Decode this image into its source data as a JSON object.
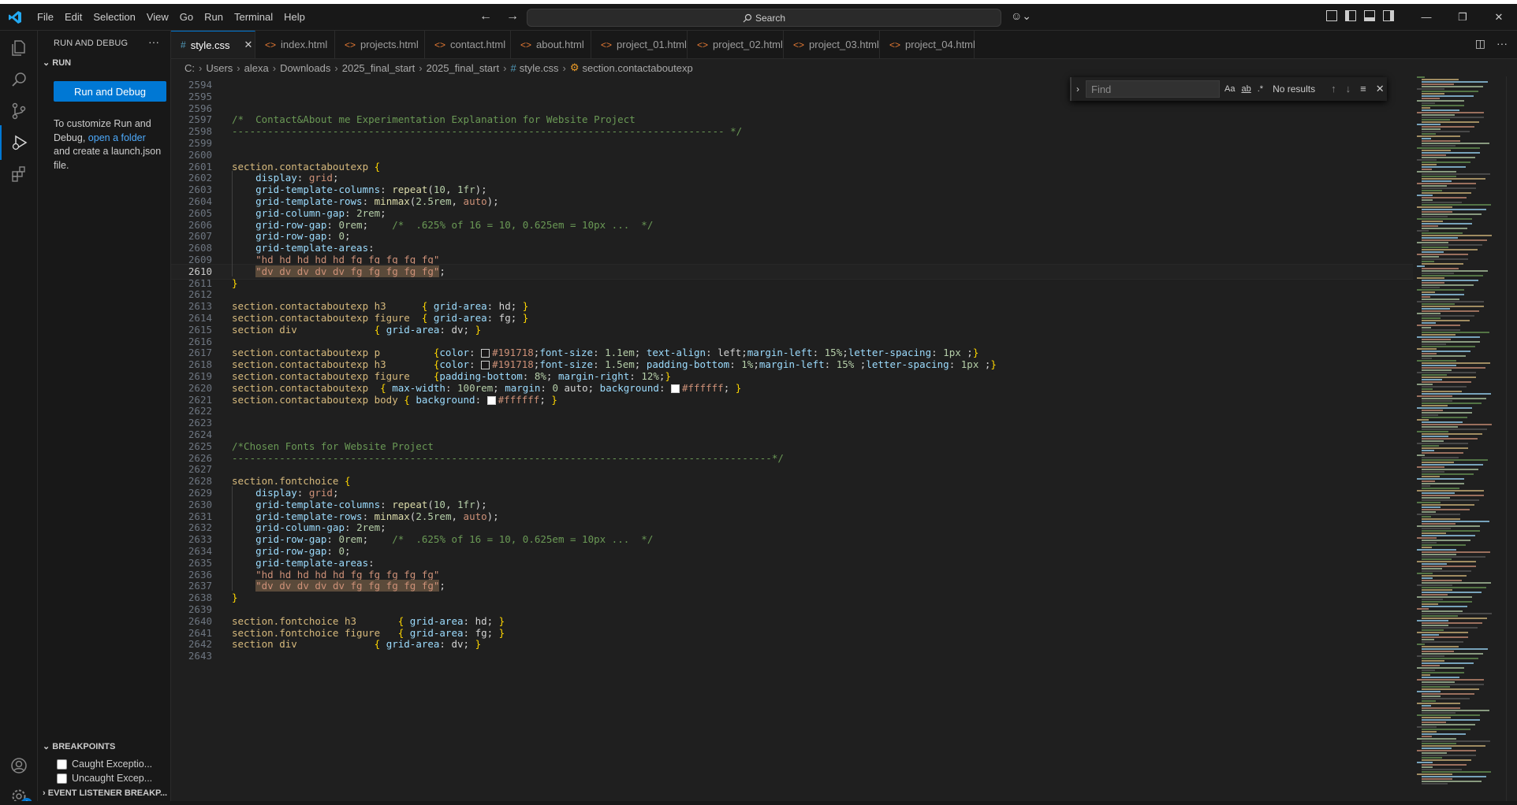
{
  "menu": [
    "File",
    "Edit",
    "Selection",
    "View",
    "Go",
    "Run",
    "Terminal",
    "Help"
  ],
  "search": {
    "label": "Search"
  },
  "sidebar": {
    "title": "RUN AND DEBUG",
    "section": "RUN",
    "run_button": "Run and Debug",
    "text_before": "To customize Run and Debug,",
    "link": "open a folder",
    "text_after": "and create a launch.json file.",
    "breakpoints_title": "BREAKPOINTS",
    "bp_items": [
      "Caught Exceptio...",
      "Uncaught Excep..."
    ],
    "event_listener": "EVENT LISTENER BREAKP..."
  },
  "tabs": [
    {
      "label": "style.css",
      "type": "css",
      "active": true
    },
    {
      "label": "index.html",
      "type": "html"
    },
    {
      "label": "projects.html",
      "type": "html"
    },
    {
      "label": "contact.html",
      "type": "html"
    },
    {
      "label": "about.html",
      "type": "html"
    },
    {
      "label": "project_01.html",
      "type": "html"
    },
    {
      "label": "project_02.html",
      "type": "html"
    },
    {
      "label": "project_03.html",
      "type": "html"
    },
    {
      "label": "project_04.html",
      "type": "html"
    }
  ],
  "breadcrumb": [
    "C:",
    "Users",
    "alexa",
    "Downloads",
    "2025_final_start",
    "2025_final_start",
    "style.css",
    "section.contactaboutexp"
  ],
  "find": {
    "placeholder": "Find",
    "result": "No results",
    "opt_case": "Aa",
    "opt_word": "ab",
    "opt_regex": ".*"
  },
  "activity_badge": "1",
  "colors": {
    "accent": "#0078d4",
    "editor_bg": "#1f1f1f",
    "swatch_dark": "#191718",
    "swatch_light": "#ffffff"
  },
  "editor": {
    "current_line": "2610",
    "lines": [
      {
        "n": "2594",
        "t": ""
      },
      {
        "n": "2595",
        "t": ""
      },
      {
        "n": "2596",
        "t": ""
      },
      {
        "n": "2597",
        "t": "/*  Contact&About me Experimentation Explanation for Website Project"
      },
      {
        "n": "2598",
        "t": "----------------------------------------------------------------------------------- */"
      },
      {
        "n": "2599",
        "t": ""
      },
      {
        "n": "2600",
        "t": ""
      },
      {
        "n": "2601",
        "t": "section.contactaboutexp {"
      },
      {
        "n": "2602",
        "t": "    display: grid;"
      },
      {
        "n": "2603",
        "t": "    grid-template-columns: repeat(10, 1fr);"
      },
      {
        "n": "2604",
        "t": "    grid-template-rows: minmax(2.5rem, auto);"
      },
      {
        "n": "2605",
        "t": "    grid-column-gap: 2rem;"
      },
      {
        "n": "2606",
        "t": "    grid-row-gap: 0rem;    /*  .625% of 16 = 10, 0.625em = 10px ...  */"
      },
      {
        "n": "2607",
        "t": "    grid-row-gap: 0;"
      },
      {
        "n": "2608",
        "t": "    grid-template-areas:"
      },
      {
        "n": "2609",
        "t": "    \"hd hd hd hd hd fg fg fg fg fg\""
      },
      {
        "n": "2610",
        "t": "    \"dv dv dv dv dv fg fg fg fg fg\";"
      },
      {
        "n": "2611",
        "t": "}"
      },
      {
        "n": "2612",
        "t": ""
      },
      {
        "n": "2613",
        "t": "section.contactaboutexp h3      { grid-area: hd; }"
      },
      {
        "n": "2614",
        "t": "section.contactaboutexp figure  { grid-area: fg; }"
      },
      {
        "n": "2615",
        "t": "section div             { grid-area: dv; }"
      },
      {
        "n": "2616",
        "t": ""
      },
      {
        "n": "2617",
        "t": "section.contactaboutexp p         {color: #191718;font-size:1.1em; text-align: left;margin-left: 15%;letter-spacing:1px ;}"
      },
      {
        "n": "2618",
        "t": "section.contactaboutexp h3        {color: #191718;font-size: 1.5em; padding-bottom: 1%;margin-left:15% ;letter-spacing:1px ;}"
      },
      {
        "n": "2619",
        "t": "section.contactaboutexp figure    {padding-bottom: 8%; margin-right: 12%;}"
      },
      {
        "n": "2620",
        "t": "section.contactaboutexp  { max-width: 100rem; margin: 0 auto; background: #ffffff; }"
      },
      {
        "n": "2621",
        "t": "section.contactaboutexp body { background: #ffffff; }"
      },
      {
        "n": "2622",
        "t": ""
      },
      {
        "n": "2623",
        "t": ""
      },
      {
        "n": "2624",
        "t": ""
      },
      {
        "n": "2625",
        "t": "/*Chosen Fonts for Website Project"
      },
      {
        "n": "2626",
        "t": "-------------------------------------------------------------------------------------------*/"
      },
      {
        "n": "2627",
        "t": ""
      },
      {
        "n": "2628",
        "t": "section.fontchoice {"
      },
      {
        "n": "2629",
        "t": "    display: grid;"
      },
      {
        "n": "2630",
        "t": "    grid-template-columns: repeat(10, 1fr);"
      },
      {
        "n": "2631",
        "t": "    grid-template-rows: minmax(2.5rem, auto);"
      },
      {
        "n": "2632",
        "t": "    grid-column-gap: 2rem;"
      },
      {
        "n": "2633",
        "t": "    grid-row-gap: 0rem;    /*  .625% of 16 = 10, 0.625em = 10px ...  */"
      },
      {
        "n": "2634",
        "t": "    grid-row-gap: 0;"
      },
      {
        "n": "2635",
        "t": "    grid-template-areas:"
      },
      {
        "n": "2636",
        "t": "    \"hd hd hd hd hd fg fg fg fg fg\""
      },
      {
        "n": "2637",
        "t": "    \"dv dv dv dv dv fg fg fg fg fg\";"
      },
      {
        "n": "2638",
        "t": "}"
      },
      {
        "n": "2639",
        "t": ""
      },
      {
        "n": "2640",
        "t": "section.fontchoice h3       { grid-area: hd; }"
      },
      {
        "n": "2641",
        "t": "section.fontchoice figure   { grid-area: fg; }"
      },
      {
        "n": "2642",
        "t": "section div             { grid-area: dv; }"
      },
      {
        "n": "2643",
        "t": ""
      }
    ]
  }
}
